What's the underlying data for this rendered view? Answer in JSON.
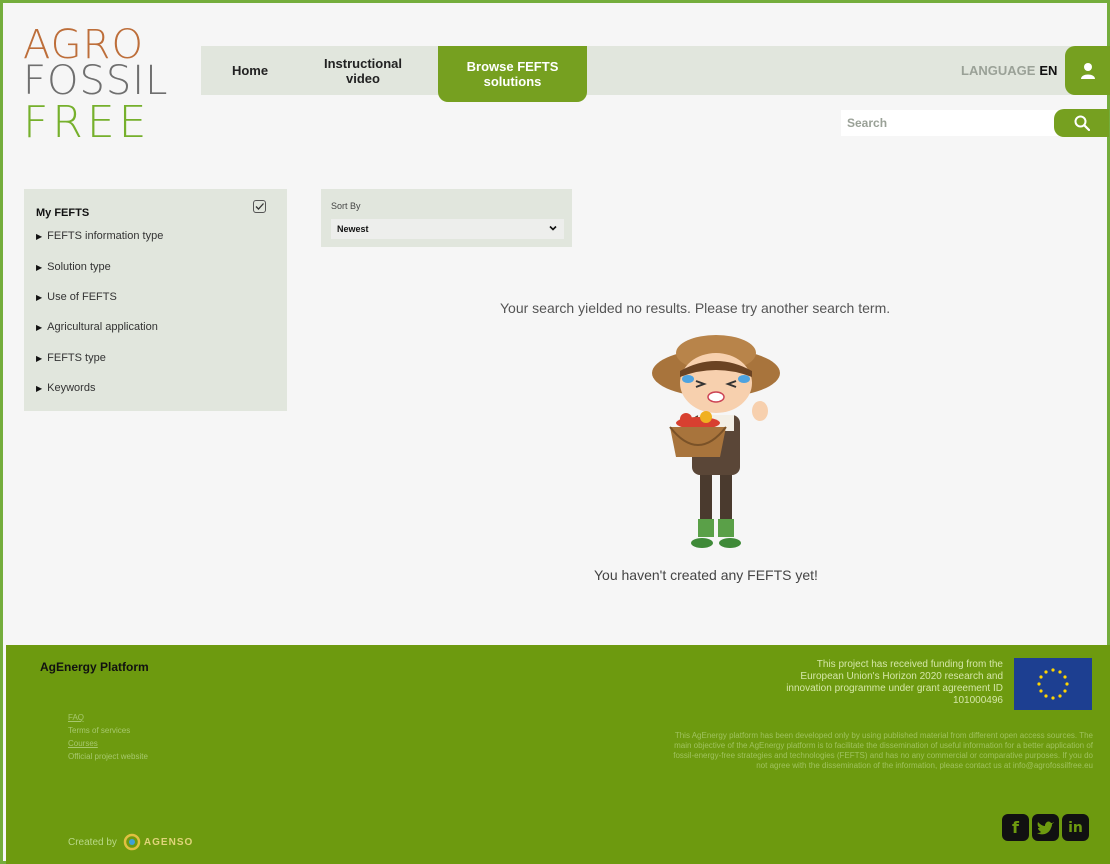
{
  "logo": {
    "line1": "AGRO",
    "line2": "FOSSIL",
    "line3": "FREE"
  },
  "nav": {
    "home": "Home",
    "instructional_video": "Instructional video",
    "browse": "Browse FEFTS solutions",
    "language_label": "LANGUAGE",
    "language_value": "EN",
    "user_icon": "user-icon"
  },
  "search": {
    "placeholder": "Search",
    "icon": "search-icon"
  },
  "sidebar": {
    "title": "My FEFTS",
    "checkbox_checked": true,
    "items": [
      {
        "label": "FEFTS information type"
      },
      {
        "label": "Solution type"
      },
      {
        "label": "Use of FEFTS"
      },
      {
        "label": "Agricultural application"
      },
      {
        "label": "FEFTS type"
      },
      {
        "label": "Keywords"
      }
    ]
  },
  "sort": {
    "label": "Sort By",
    "value": "Newest"
  },
  "main": {
    "no_results": "Your search yielded no results. Please try another search term.",
    "no_fefts": "You haven't created any FEFTS yet!"
  },
  "footer": {
    "title": "AgEnergy Platform",
    "links": [
      "FAQ",
      "Terms of services",
      "Courses",
      "Official project website"
    ],
    "funding": "This project has received funding from the European Union's Horizon 2020 research and innovation programme under grant agreement ID 101000496",
    "disclaimer": "This AgEnergy platform has been developed only by using published material from different open access sources. The main objective of the AgEnergy platform is to facilitate the dissemination of useful information for a better application of fossil-energy-free strategies and technologies (FEFTS) and has no any commercial or comparative purposes. If you do not agree with the dissemination of the information, please contact us at info@agrofossilfree.eu",
    "created_by": "Created by",
    "creator_logo": "AGENSO",
    "socials": [
      "facebook-icon",
      "twitter-icon",
      "linkedin-icon"
    ]
  },
  "colors": {
    "accent": "#76a020",
    "frame": "#74ad3c",
    "footer": "#6d9a0f",
    "panel": "#e1e6dd"
  }
}
